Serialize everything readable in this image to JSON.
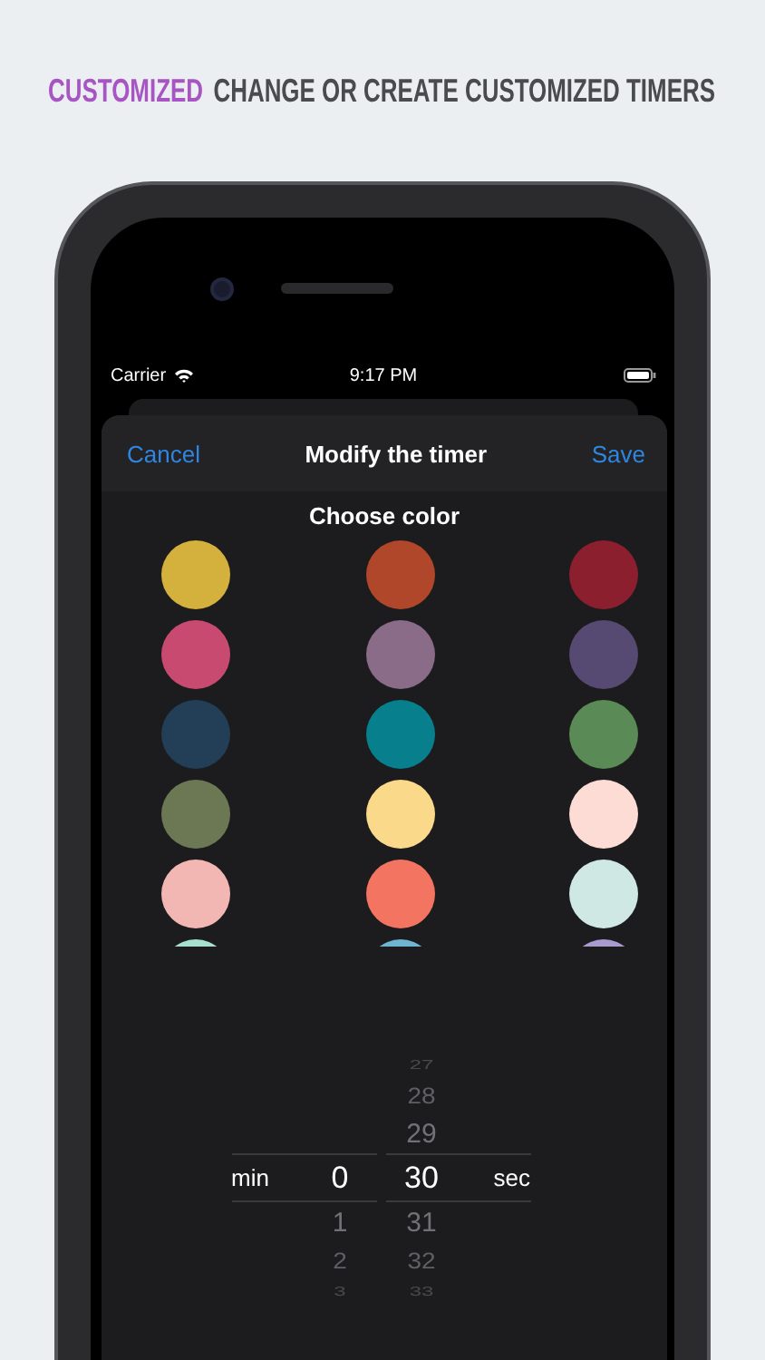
{
  "header": {
    "accent": "CUSTOMIZED",
    "headline": "CHANGE OR CREATE CUSTOMIZED TIMERS"
  },
  "status_bar": {
    "carrier": "Carrier",
    "time": "9:17 PM"
  },
  "sheet": {
    "cancel": "Cancel",
    "title": "Modify the timer",
    "save": "Save"
  },
  "color_section": {
    "title": "Choose color",
    "swatches": [
      {
        "color": "#d4b03c"
      },
      {
        "color": "#b0472a"
      },
      {
        "color": "#8c1f2e"
      },
      {
        "color": "#c94a70"
      },
      {
        "color": "#8a6c88"
      },
      {
        "color": "#574a72"
      },
      {
        "color": "#233e57"
      },
      {
        "color": "#087f8c"
      },
      {
        "color": "#5a8a55"
      },
      {
        "color": "#6b7853"
      },
      {
        "color": "#fbd98a"
      },
      {
        "color": "#fddcd5"
      },
      {
        "color": "#f2b6b3"
      },
      {
        "color": "#f47462"
      },
      {
        "color": "#cfe8e3"
      },
      {
        "color": "#a8e0d0"
      },
      {
        "color": "#6fb4d0"
      },
      {
        "color": "#a99ad0"
      }
    ]
  },
  "picker": {
    "columns": [
      {
        "label": "min",
        "values": [
          {
            "text": "0",
            "selected": true
          },
          {
            "text": "1",
            "selected": false
          },
          {
            "text": "2",
            "selected": false
          },
          {
            "text": "3",
            "selected": false
          }
        ]
      },
      {
        "label": "sec",
        "values": [
          {
            "text": "27",
            "selected": false
          },
          {
            "text": "28",
            "selected": false
          },
          {
            "text": "29",
            "selected": false
          },
          {
            "text": "30",
            "selected": true
          },
          {
            "text": "31",
            "selected": false
          },
          {
            "text": "32",
            "selected": false
          },
          {
            "text": "33",
            "selected": false
          }
        ]
      }
    ]
  }
}
